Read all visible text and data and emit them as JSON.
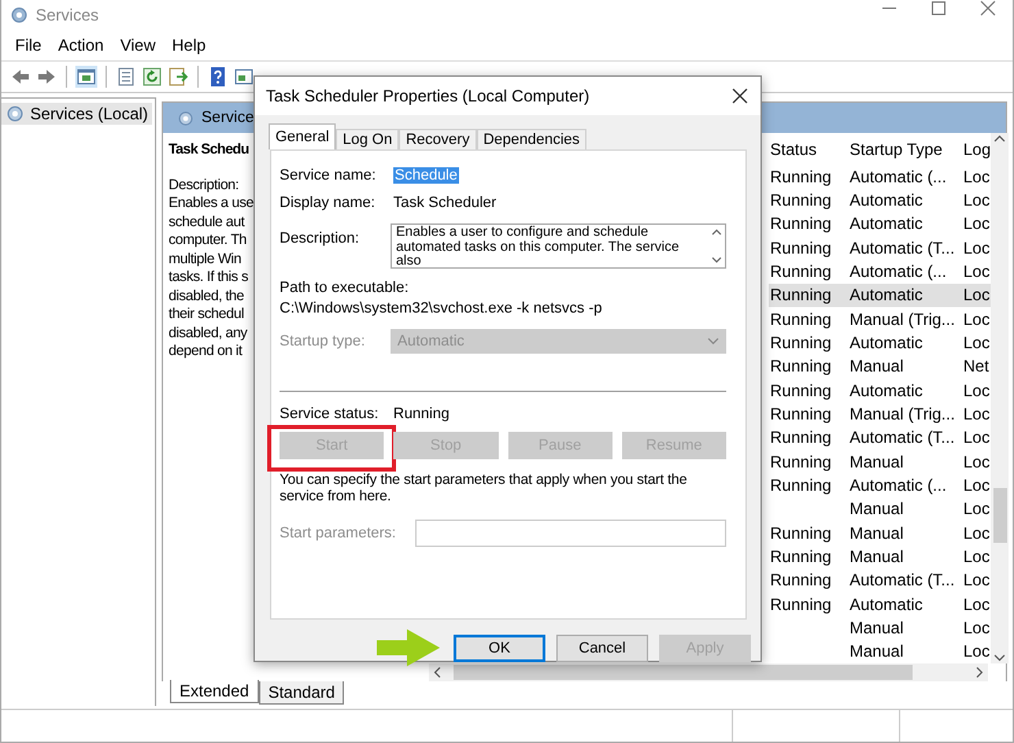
{
  "window": {
    "title": "Services"
  },
  "menu": [
    "File",
    "Action",
    "View",
    "Help"
  ],
  "tree": [
    {
      "label": "Services (Local)",
      "selected": true
    }
  ],
  "detail": {
    "header": "Service",
    "title": "Task Schedu",
    "description_label": "Description:",
    "description_lines": [
      "Enables a use",
      "schedule aut",
      "computer. Th",
      "multiple Win",
      "tasks. If this s",
      "disabled, the",
      "their schedul",
      "disabled, any",
      "depend on it"
    ]
  },
  "list": {
    "columns": [
      "Status",
      "Startup Type",
      "Log"
    ],
    "rows": [
      {
        "status": "Running",
        "startup_type": "Automatic (...",
        "log_on": "Loc",
        "selected": false
      },
      {
        "status": "Running",
        "startup_type": "Automatic",
        "log_on": "Loc",
        "selected": false
      },
      {
        "status": "Running",
        "startup_type": "Automatic",
        "log_on": "Loc",
        "selected": false
      },
      {
        "status": "Running",
        "startup_type": "Automatic (T...",
        "log_on": "Loc",
        "selected": false
      },
      {
        "status": "Running",
        "startup_type": "Automatic (...",
        "log_on": "Loc",
        "selected": false
      },
      {
        "status": "Running",
        "startup_type": "Automatic",
        "log_on": "Loc",
        "selected": true
      },
      {
        "status": "Running",
        "startup_type": "Manual (Trig...",
        "log_on": "Loc",
        "selected": false
      },
      {
        "status": "Running",
        "startup_type": "Automatic",
        "log_on": "Loc",
        "selected": false
      },
      {
        "status": "Running",
        "startup_type": "Manual",
        "log_on": "Net",
        "selected": false
      },
      {
        "status": "Running",
        "startup_type": "Automatic",
        "log_on": "Loc",
        "selected": false
      },
      {
        "status": "Running",
        "startup_type": "Manual (Trig...",
        "log_on": "Loc",
        "selected": false
      },
      {
        "status": "Running",
        "startup_type": "Automatic (T...",
        "log_on": "Loc",
        "selected": false
      },
      {
        "status": "Running",
        "startup_type": "Manual",
        "log_on": "Loc",
        "selected": false
      },
      {
        "status": "Running",
        "startup_type": "Automatic (...",
        "log_on": "Loc",
        "selected": false
      },
      {
        "startup_type": "Manual",
        "log_on": "Loc",
        "selected": false
      },
      {
        "status": "Running",
        "startup_type": "Manual",
        "log_on": "Loc",
        "selected": false
      },
      {
        "status": "Running",
        "startup_type": "Manual",
        "log_on": "Loc",
        "selected": false
      },
      {
        "status": "Running",
        "startup_type": "Automatic (T...",
        "log_on": "Loc",
        "selected": false
      },
      {
        "status": "Running",
        "startup_type": "Automatic",
        "log_on": "Loc",
        "selected": false
      },
      {
        "startup_type": "Manual",
        "log_on": "Loc",
        "selected": false
      },
      {
        "startup_type": "Manual",
        "log_on": "Loc",
        "selected": false
      }
    ]
  },
  "view_tabs": [
    {
      "label": "Extended",
      "selected": true
    },
    {
      "label": "Standard",
      "selected": false
    }
  ],
  "dialog": {
    "title": "Task Scheduler Properties (Local Computer)",
    "tabs": [
      {
        "label": "General",
        "selected": true
      },
      {
        "label": "Log On",
        "selected": false
      },
      {
        "label": "Recovery",
        "selected": false
      },
      {
        "label": "Dependencies",
        "selected": false
      }
    ],
    "service_name": {
      "label": "Service name:",
      "value": "Schedule"
    },
    "display_name": {
      "label": "Display name:",
      "value": "Task Scheduler"
    },
    "description": {
      "label": "Description:",
      "text": "Enables a user to configure and schedule automated tasks on this computer. The service also"
    },
    "path": {
      "label": "Path to executable:",
      "value": "C:\\Windows\\system32\\svchost.exe -k netsvcs -p"
    },
    "startup_type": {
      "label": "Startup type:",
      "value": "Automatic",
      "disabled": true
    },
    "service_status": {
      "label": "Service status:",
      "value": "Running"
    },
    "service_buttons": [
      {
        "label": "Start",
        "disabled": true,
        "highlighted": true
      },
      {
        "label": "Stop",
        "disabled": true,
        "highlighted": false
      },
      {
        "label": "Pause",
        "disabled": true,
        "highlighted": false
      },
      {
        "label": "Resume",
        "disabled": true,
        "highlighted": false
      }
    ],
    "note": "You can specify the start parameters that apply when you start the service from here.",
    "start_parameters": {
      "label": "Start parameters:",
      "disabled": true
    },
    "buttons": [
      {
        "label": "OK",
        "default": true,
        "disabled": false,
        "pointed": true
      },
      {
        "label": "Cancel",
        "default": false,
        "disabled": false,
        "pointed": false
      },
      {
        "label": "Apply",
        "default": false,
        "disabled": true,
        "pointed": false
      }
    ]
  }
}
